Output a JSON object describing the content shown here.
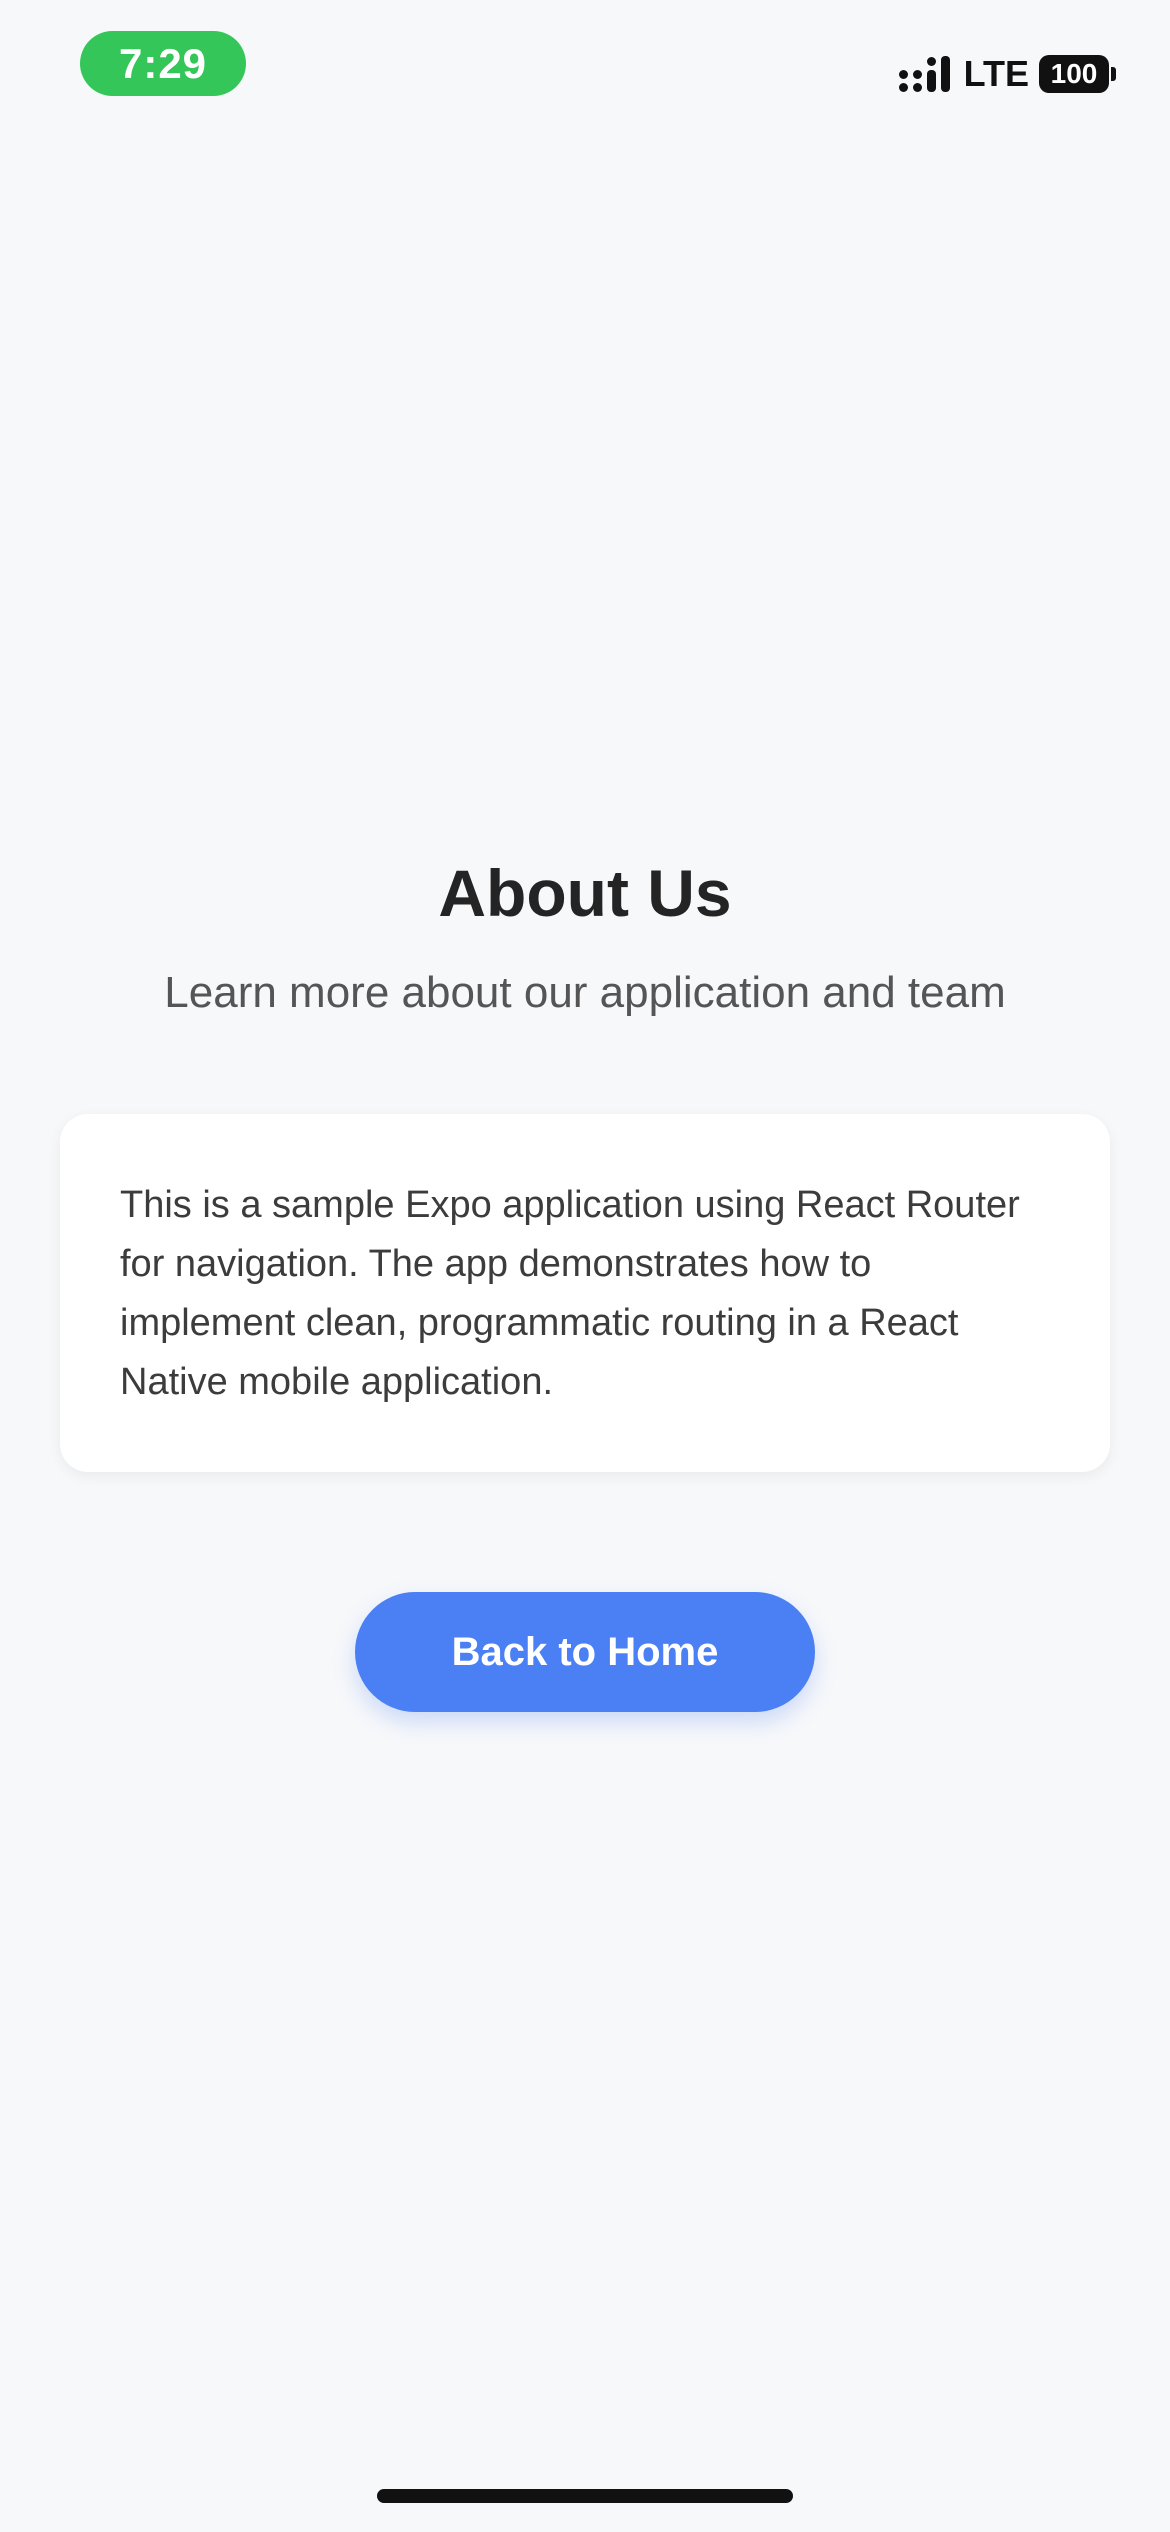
{
  "status_bar": {
    "time": "7:29",
    "network": "LTE",
    "battery": "100",
    "time_pill_color": "#34c659"
  },
  "main": {
    "title": "About Us",
    "subtitle": "Learn more about our application and team",
    "description": "This is a sample Expo application using React Router for navigation. The app demonstrates how to implement clean, programmatic routing in a React Native mobile application.",
    "back_button_label": "Back to Home",
    "accent_color": "#4a80f3"
  }
}
